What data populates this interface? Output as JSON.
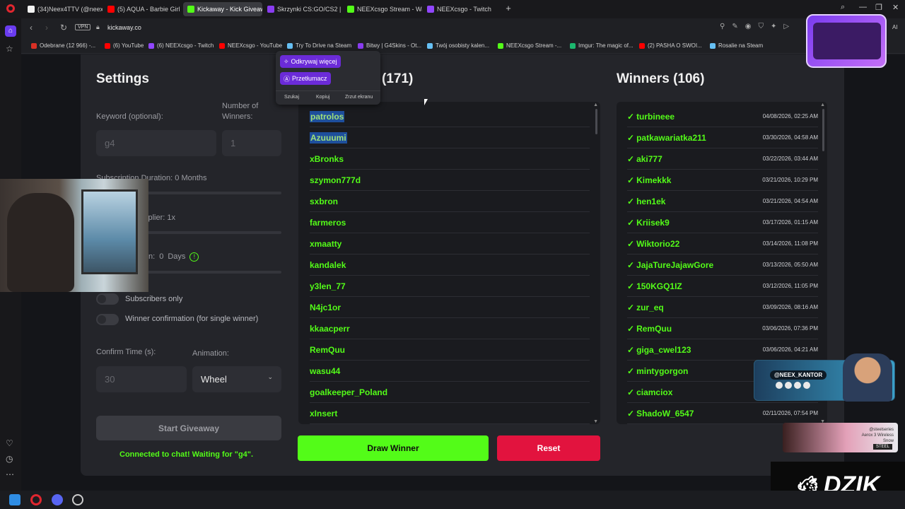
{
  "tabs": [
    {
      "label": "(34)Neex4TTV (@neex4tt...",
      "color": "#f2f2f2"
    },
    {
      "label": "(5) AQUA - Barbie Girl",
      "color": "#ff0000"
    },
    {
      "label": "Kickaway - Kick Giveaway",
      "color": "#53fc18"
    },
    {
      "label": "Skrzynki CS:GO/CS2 | G4S...",
      "color": "#8a3cf0"
    },
    {
      "label": "NEEXcsgo Stream - Watch...",
      "color": "#53fc18"
    },
    {
      "label": "NEEXcsgo - Twitch",
      "color": "#9146ff"
    }
  ],
  "address": {
    "vpn": "VPN",
    "url": "kickaway.co",
    "ai": "AI"
  },
  "bookmarks": [
    {
      "label": "Odebrane (12 966) -...",
      "color": "#d93025"
    },
    {
      "label": "(6) YouTube",
      "color": "#ff0000"
    },
    {
      "label": "(6) NEEXcsgo - Twitch",
      "color": "#9146ff"
    },
    {
      "label": "NEEXcsgo - YouTube",
      "color": "#ff0000"
    },
    {
      "label": "Try To Drive na Steam",
      "color": "#66c0f4"
    },
    {
      "label": "Bitwy | G4Skins - Ot...",
      "color": "#8a3cf0"
    },
    {
      "label": "Twój osobisty kalen...",
      "color": "#66c0f4"
    },
    {
      "label": "NEEXcsgo Stream -...",
      "color": "#53fc18"
    },
    {
      "label": "Imgur: The magic of...",
      "color": "#1bb76e"
    },
    {
      "label": "(2) PASHA O SWOI...",
      "color": "#ff0000"
    },
    {
      "label": "Rosalie na Steam",
      "color": "#66c0f4"
    }
  ],
  "popup": {
    "discover": "Odkrywaj więcej",
    "translate": "Przetłumacz",
    "actions": [
      "Szukaj",
      "Kopiuj",
      "Zrzut ekranu"
    ]
  },
  "settings": {
    "title": "Settings",
    "keyword_label": "Keyword (optional):",
    "keyword_value": "g4",
    "winners_label": "Number of Winners:",
    "winners_value": "1",
    "sub_duration": "Subscription Duration: 0 Months",
    "multiplier": "tiplier: 1x",
    "days_prefix": "n:",
    "days_value": "0",
    "days_unit": "Days",
    "info_glyph": "!",
    "subscribers_only": "Subscribers only",
    "winner_confirmation": "Winner confirmation (for single winner)",
    "confirm_time_label": "Confirm Time (s):",
    "confirm_time_value": "30",
    "animation_label": "Animation:",
    "animation_value": "Wheel",
    "start_button": "Start Giveaway",
    "status": "Connected to chat! Waiting for \"g4\"."
  },
  "participants": {
    "title_visible": "(171)",
    "names": [
      "patrolos",
      "Azuuumi",
      "xBronks",
      "szymon777d",
      "sxbron",
      "farmeros",
      "xmaatty",
      "kandalek",
      "y3len_77",
      "N4jc1or",
      "kkaacperr",
      "RemQuu",
      "wasu44",
      "goalkeeper_Poland",
      "xInsert"
    ],
    "highlighted": [
      0,
      1
    ]
  },
  "winners": {
    "title": "Winners (106)",
    "check": "✓",
    "items": [
      {
        "name": "turbineee",
        "date": "04/08/2026, 02:25 AM"
      },
      {
        "name": "patkawariatka211",
        "date": "03/30/2026, 04:58 AM"
      },
      {
        "name": "aki777",
        "date": "03/22/2026, 03:44 AM"
      },
      {
        "name": "Kimekkk",
        "date": "03/21/2026, 10:29 PM"
      },
      {
        "name": "hen1ek",
        "date": "03/21/2026, 04:54 AM"
      },
      {
        "name": "Kriisek9",
        "date": "03/17/2026, 01:15 AM"
      },
      {
        "name": "Wiktorio22",
        "date": "03/14/2026, 11:08 PM"
      },
      {
        "name": "JajaTureJajawGore",
        "date": "03/13/2026, 05:50 AM"
      },
      {
        "name": "150KGQ1IZ",
        "date": "03/12/2026, 11:05 PM"
      },
      {
        "name": "zur_eq",
        "date": "03/09/2026, 08:16 AM"
      },
      {
        "name": "RemQuu",
        "date": "03/06/2026, 07:36 PM"
      },
      {
        "name": "giga_cwel123",
        "date": "03/06/2026, 04:21 AM"
      },
      {
        "name": "mintygorgon",
        "date": ""
      },
      {
        "name": "ciamciox",
        "date": "0"
      },
      {
        "name": "ShadoW_6547",
        "date": "02/11/2026, 07:54 PM"
      }
    ]
  },
  "actions": {
    "draw": "Draw Winner",
    "reset": "Reset"
  },
  "overlays": {
    "instagram": "@NEEX_KANTOR",
    "steelseries": "@steelseries\nAerox 3 Wireless\nSnow",
    "steelseries_badge": "STEEL",
    "brand": "DZIK"
  },
  "colors": {
    "accent": "#53fc18",
    "danger": "#e2133e",
    "opera": "#e0262f"
  }
}
